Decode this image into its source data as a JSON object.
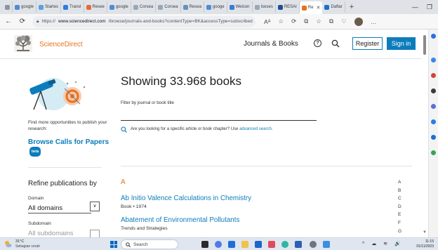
{
  "browser": {
    "tabs": [
      {
        "label": "google",
        "color": "#4f8bd6"
      },
      {
        "label": "Startes",
        "color": "#5aa0e0"
      },
      {
        "label": "Transl",
        "color": "#2b7de0"
      },
      {
        "label": "Resee",
        "color": "#e46a3c"
      },
      {
        "label": "google",
        "color": "#4f8bd6"
      },
      {
        "label": "Corsea",
        "color": "#9aa7b5"
      },
      {
        "label": "Corsea",
        "color": "#9aa7b5"
      },
      {
        "label": "Resea",
        "color": "#6c8fb8"
      },
      {
        "label": "googe",
        "color": "#4f8bd6"
      },
      {
        "label": "Welcon",
        "color": "#3a7bd5"
      },
      {
        "label": "Iseses",
        "color": "#9aa7b5"
      },
      {
        "label": "RESAI",
        "color": "#1d4f91"
      }
    ],
    "active_tab": {
      "label": "Re",
      "close": "✕",
      "color": "#e9711c"
    },
    "extra_tab": {
      "label": "Daftar",
      "color": "#1d6fc9"
    },
    "new_tab": "+",
    "window_controls": [
      "—",
      "❐"
    ],
    "url_prefix": "https://",
    "url_host": "www.sciencedirect.com",
    "url_path": "/browse/journals-and-books?contentType=BK&accessType=subscribed",
    "read_aloud": "Aᴬ",
    "toolbar_glyphs": [
      "☆",
      "⟳",
      "⧉",
      "☆",
      "⧉",
      "♡"
    ],
    "more": "…"
  },
  "site": {
    "brand": "ScienceDirect",
    "nav_journals": "Journals & Books",
    "help": "?",
    "register": "Register",
    "signin": "Sign in"
  },
  "left_rail": {
    "promo_text": "Find more opportunities to publish your research:",
    "promo_link": "Browse Calls for Papers",
    "beta": "beta",
    "refine_title": "Refine publications by",
    "domain_label": "Domain",
    "domain_value": "All domains",
    "subdomain_label": "Subdomain",
    "subdomain_value": "All subdomains",
    "chevron": "∨"
  },
  "main": {
    "title": "Showing 33.968 books",
    "filter_label": "Filter by journal or book title",
    "filter_value": "",
    "hint_text": "Are you looking for a specific article or book chapter? Use ",
    "hint_link": "advanced search",
    "hint_end": ".",
    "letter": "A",
    "books": [
      {
        "title": "Ab Initio Valence Calculations in Chemistry",
        "meta": "Book • 1974"
      },
      {
        "title": "Abatement of Environmental Pollutants",
        "meta": "Trends and Strategies"
      }
    ],
    "az_index": [
      "A",
      "B",
      "C",
      "D",
      "E",
      "F",
      "G"
    ]
  },
  "taskbar": {
    "weather_temp": "31°C",
    "weather_desc": "Sebagian cerah",
    "search_placeholder": "Search",
    "tray": "^ ☁ ≋ 🔊",
    "time": "11:15",
    "date": "01/11/2023"
  },
  "colors": {
    "accent_orange": "#e9711c",
    "link_blue": "#0c7dbb"
  }
}
